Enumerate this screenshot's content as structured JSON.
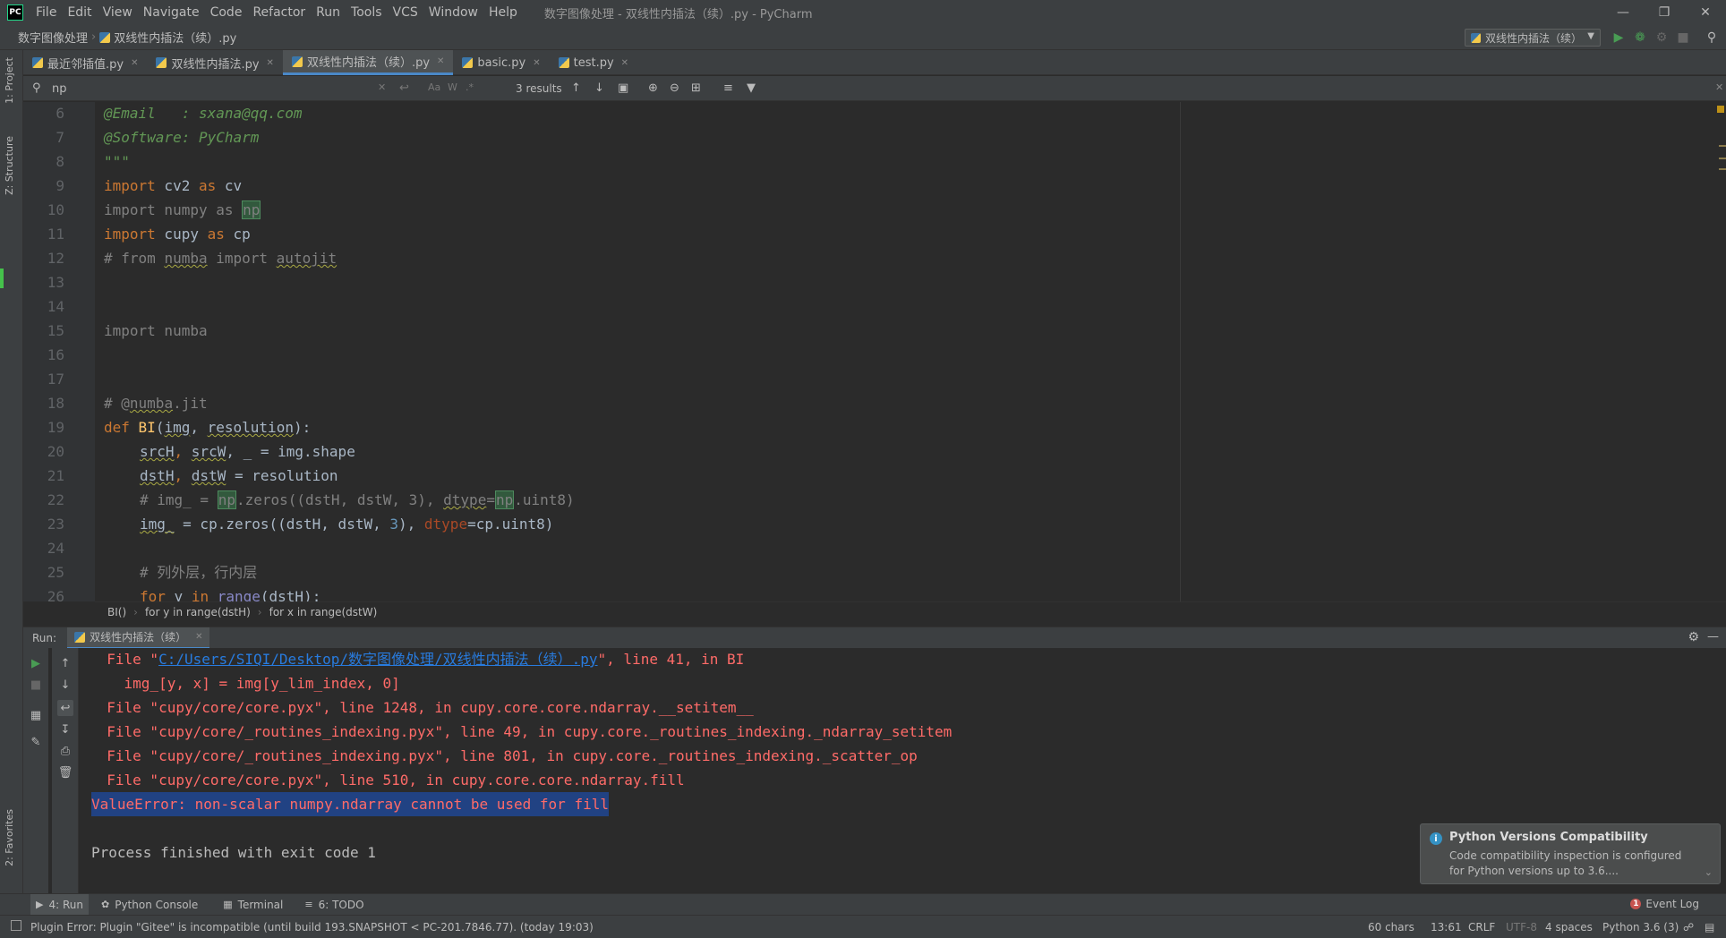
{
  "app": {
    "logo_text": "PC",
    "window_title": "数字图像处理 - 双线性内插法（续）.py - PyCharm",
    "menu": [
      "File",
      "Edit",
      "View",
      "Navigate",
      "Code",
      "Refactor",
      "Run",
      "Tools",
      "VCS",
      "Window",
      "Help"
    ]
  },
  "navbar": {
    "project": "数字图像处理",
    "file": "双线性内插法（续）.py",
    "run_config": "双线性内插法（续）"
  },
  "left_strip": {
    "project": "1: Project",
    "structure": "Z: Structure",
    "favorites": "2: Favorites"
  },
  "tabs": [
    {
      "label": "最近邻插值.py"
    },
    {
      "label": "双线性内插法.py"
    },
    {
      "label": "双线性内插法（续）.py"
    },
    {
      "label": "basic.py"
    },
    {
      "label": "test.py"
    }
  ],
  "search": {
    "query": "np",
    "results": "3 results",
    "opt_case": "Aa",
    "opt_word": "W",
    "opt_regex": ".*"
  },
  "editor": {
    "line_numbers": [
      "6",
      "7",
      "8",
      "9",
      "10",
      "11",
      "12",
      "13",
      "14",
      "15",
      "16",
      "17",
      "18",
      "19",
      "20",
      "21",
      "22",
      "23",
      "24",
      "25",
      "26"
    ],
    "lines": {
      "l6_text": "@Email   : sxana@qq.com",
      "l7_text": "@Software: PyCharm",
      "l8_text": "\"\"\"",
      "l9_kw1": "import",
      "l9_mod": " cv2 ",
      "l9_kw2": "as",
      "l9_alias": " cv",
      "l10_text": "import numpy as ",
      "l10_hl": "np",
      "l11_kw1": "import",
      "l11_mod": " cupy ",
      "l11_kw2": "as",
      "l11_alias": " cp",
      "l12_a": "# from ",
      "l12_b": "numba",
      "l12_c": " import ",
      "l12_d": "autojit",
      "l15_text": "import numba",
      "l18_a": "# @",
      "l18_b": "numba",
      "l18_c": ".jit",
      "l19_kw": "def",
      "l19_fn": " BI",
      "l19_p1": "(",
      "l19_p2": "img",
      "l19_p3": ", ",
      "l19_p4": "resolution",
      "l19_p5": "):",
      "l20_a": "srcH",
      "l20_b": ", ",
      "l20_c": "srcW",
      "l20_d": ", _ = img.shape",
      "l21_a": "dstH",
      "l21_b": ", ",
      "l21_c": "dstW",
      "l21_d": " = resolution",
      "l22_a": "# img_ = ",
      "l22_b": "np",
      "l22_c": ".zeros((dstH, dstW, 3), ",
      "l22_d": "dtype",
      "l22_e": "=",
      "l22_f": "np",
      "l22_g": ".uint8)",
      "l23_a": "img_",
      "l23_b": " = cp.zeros((dstH, dstW, ",
      "l23_c": "3",
      "l23_d": "), ",
      "l23_e": "dtype",
      "l23_f": "=cp.uint8)",
      "l25_text": "# 列外层，行内层",
      "l26_kw1": "for",
      "l26_b": " y ",
      "l26_kw2": "in",
      "l26_c": " ",
      "l26_d": "range",
      "l26_e": "(dstH):"
    },
    "breadcrumb": [
      "BI()",
      "for y in range(dstH)",
      "for x in range(dstW)"
    ]
  },
  "run": {
    "label": "Run:",
    "tab": "双线性内插法（续）",
    "console": {
      "c1_a": "  File \"",
      "c1_link": "C:/Users/SIQI/Desktop/数字图像处理/双线性内插法（续）.py",
      "c1_b": "\", line 41, in BI",
      "c2": "    img_[y, x] = img[y_lim_index, 0]",
      "c3": "  File \"cupy/core/core.pyx\", line 1248, in cupy.core.core.ndarray.__setitem__",
      "c4": "  File \"cupy/core/_routines_indexing.pyx\", line 49, in cupy.core._routines_indexing._ndarray_setitem",
      "c5": "  File \"cupy/core/_routines_indexing.pyx\", line 801, in cupy.core._routines_indexing._scatter_op",
      "c6": "  File \"cupy/core/core.pyx\", line 510, in cupy.core.core.ndarray.fill",
      "c7": "ValueError: non-scalar numpy.ndarray cannot be used for fill",
      "c9": "Process finished with exit code 1"
    }
  },
  "notification": {
    "title": "Python Versions Compatibility",
    "body": "Code compatibility inspection is configured for Python versions up to 3.6...."
  },
  "bottom_tabs": [
    {
      "label": "4: Run"
    },
    {
      "label": "Python Console"
    },
    {
      "label": "Terminal"
    },
    {
      "label": "6: TODO"
    }
  ],
  "event_log": {
    "count": "1",
    "label": "Event Log"
  },
  "status": {
    "message": "Plugin Error: Plugin \"Gitee\" is incompatible (until build 193.SNAPSHOT < PC-201.7846.77). (today 19:03)",
    "chars": "60 chars",
    "position": "13:61",
    "line_sep": "CRLF",
    "encoding": "UTF-8",
    "indent": "4 spaces",
    "interpreter": "Python 3.6 (3)"
  }
}
